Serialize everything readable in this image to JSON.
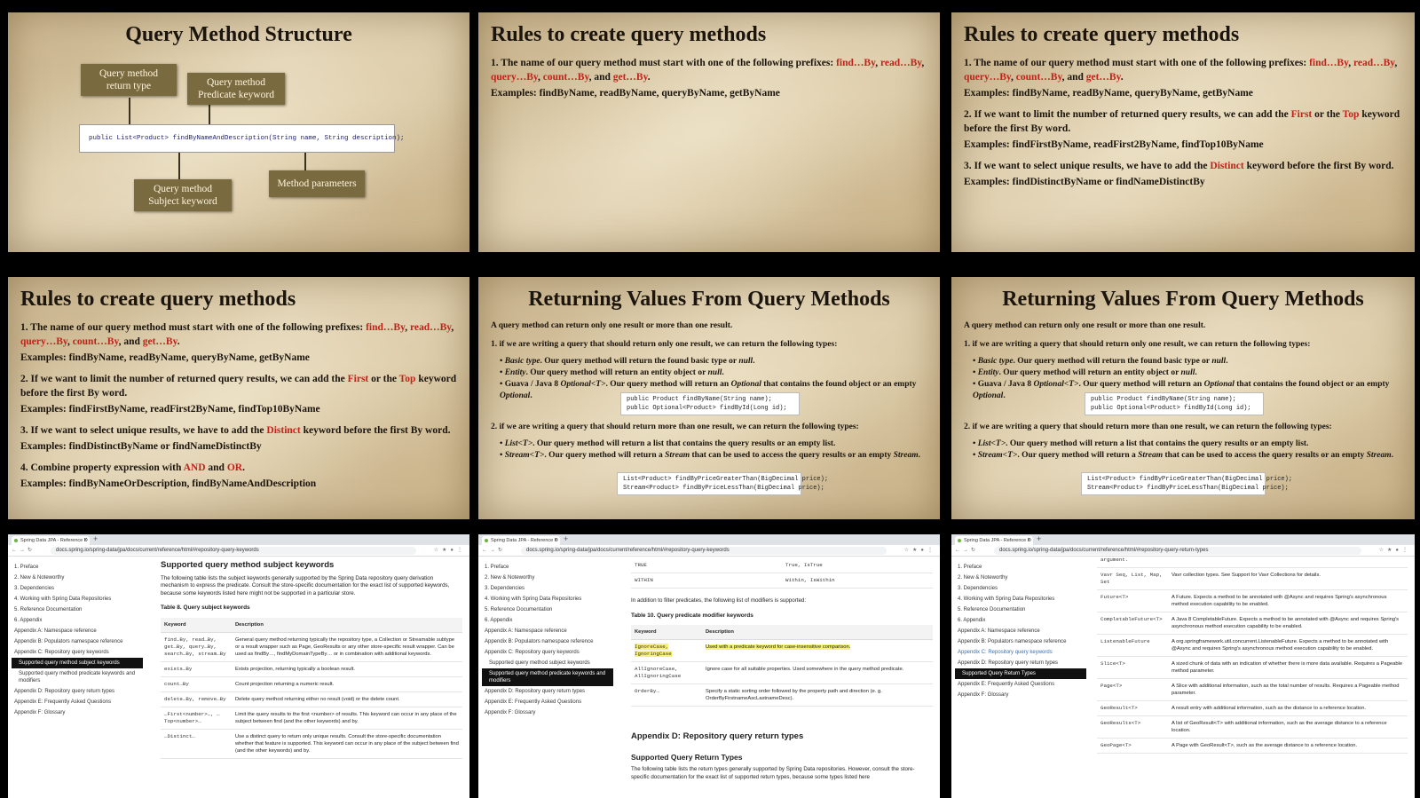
{
  "slide1": {
    "title": "Query Method Structure",
    "box_return": "Query method return type",
    "box_predicate": "Query method Predicate keyword",
    "signature": "public List<Product> findByNameAndDescription(String name, String description);",
    "box_subject": "Query method Subject keyword",
    "box_params": "Method parameters"
  },
  "rules": {
    "title": "Rules to create query methods",
    "r1_text": "1. The name of our query method must start with one of the following prefixes: ",
    "r1_p1": "find…By",
    "r1_p2": "read…By",
    "r1_p3": "query…By",
    "r1_p4": "count…By",
    "r1_and": ", and ",
    "r1_p5": "get…By",
    "r1_ex": "Examples: findByName, readByName, queryByName, getByName",
    "r2_a": "2. If we want to limit the number of returned query results, we can add the ",
    "r2_first": "First",
    "r2_or": " or the ",
    "r2_top": "Top",
    "r2_b": " keyword before the first By word.",
    "r2_ex": "Examples: findFirstByName, readFirst2ByName, findTop10ByName",
    "r3_a": "3. If we want to select unique results, we have to add the ",
    "r3_distinct": "Distinct",
    "r3_b": " keyword before the first By word.",
    "r3_ex": "Examples: findDistinctByName or findNameDistinctBy",
    "r4_a": "4. Combine property expression with ",
    "r4_and": "AND",
    "r4_mid": " and ",
    "r4_or": "OR",
    "r4_ex": "Examples: findByNameOrDescription, findByNameAndDescription"
  },
  "returning": {
    "title": "Returning Values From Query Methods",
    "intro": "A query method can return only one result or more than one result.",
    "one": "1. if we are writing a query that should return only one result, we can return the following types:",
    "b1_label": "Basic type",
    "b1_text": ". Our query method will return the found basic type or ",
    "b1_null": "null",
    "b2_label": "Entity",
    "b2_text": ". Our query method will return an entity object or ",
    "b2_null": "null",
    "b3_a": "Guava / Java 8 ",
    "b3_opt": "Optional<T>",
    "b3_b": ". Our query method will return an ",
    "b3_opt2": "Optional",
    "b3_c": " that contains the found object or an empty ",
    "b3_opt3": "Optional",
    "code1_a": "public Product findByName(String name);",
    "code1_b": "public Optional<Product> findById(Long id);",
    "many": "2. if we are writing a query that should return more than one result, we can return the following types:",
    "m1_label": "List<T>",
    "m1_text": ". Our query method will return a list that contains the query results or an empty list.",
    "m2_label": "Stream<T>",
    "m2_text": ". Our query method will return a ",
    "m2_stream": "Stream",
    "m2_text2": " that can be used to access the query results or an empty ",
    "m2_stream2": "Stream",
    "code2_a": "List<Product> findByPriceGreaterThan(BigDecimal price);",
    "code2_b": "Stream<Product> findByPriceLessThan(BigDecimal price);"
  },
  "browser": {
    "tab": "Spring Data JPA - Reference D",
    "url1": "docs.spring.io/spring-data/jpa/docs/current/reference/html/#repository-query-keywords",
    "url3": "docs.spring.io/spring-data/jpa/docs/current/reference/html/#repository-query-return-types",
    "nav": [
      "1. Preface",
      "2. New & Noteworthy",
      "3. Dependencies",
      "4. Working with Spring Data Repositories",
      "5. Reference Documentation",
      "6. Appendix",
      "Appendix A: Namespace reference",
      "Appendix B: Populators namespace reference",
      "Appendix C: Repository query keywords",
      "Supported query method subject keywords",
      "Supported query method predicate keywords and modifiers",
      "Appendix D: Repository query return types",
      "Appendix E: Frequently Asked Questions",
      "Appendix F: Glossary"
    ],
    "nav3": [
      "1. Preface",
      "2. New & Noteworthy",
      "3. Dependencies",
      "4. Working with Spring Data Repositories",
      "5. Reference Documentation",
      "6. Appendix",
      "Appendix A: Namespace reference",
      "Appendix B: Populators namespace reference",
      "Appendix C: Repository query keywords",
      "Appendix D: Repository query return types",
      "Supported Query Return Types",
      "Appendix E: Frequently Asked Questions",
      "Appendix F: Glossary"
    ],
    "p1": {
      "h": "Supported query method subject keywords",
      "intro": "The following table lists the subject keywords generally supported by the Spring Data repository query derivation mechanism to express the predicate. Consult the store-specific documentation for the exact list of supported keywords, because some keywords listed here might not be supported in a particular store.",
      "cap": "Table 8. Query subject keywords",
      "th1": "Keyword",
      "th2": "Description",
      "rows": [
        [
          "find…By, read…By, get…By, query…By, search…By, stream…By",
          "General query method returning typically the repository type, a Collection or Streamable subtype or a result wrapper such as Page, GeoResults or any other store-specific result wrapper. Can be used as findBy…, findMyDomainTypeBy… or in combination with additional keywords."
        ],
        [
          "exists…By",
          "Exists projection, returning typically a boolean result."
        ],
        [
          "count…By",
          "Count projection returning a numeric result."
        ],
        [
          "delete…By, remove…By",
          "Delete query method returning either no result (void) or the delete count."
        ],
        [
          "…First<number>…, …Top<number>…",
          "Limit the query results to the first <number> of results. This keyword can occur in any place of the subject between find (and the other keywords) and by."
        ],
        [
          "…Distinct…",
          "Use a distinct query to return only unique results. Consult the store-specific documentation whether that feature is supported. This keyword can occur in any place of the subject between find (and the other keywords) and by."
        ]
      ]
    },
    "p2": {
      "r1k": "TRUE",
      "r1v": "True, IsTrue",
      "r2k": "WITHIN",
      "r2v": "Within, IsWithin",
      "intro": "In addition to filter predicates, the following list of modifiers is supported:",
      "cap": "Table 10. Query predicate modifier keywords",
      "th1": "Keyword",
      "th2": "Description",
      "rows": [
        [
          "IgnoreCase, IgnoringCase",
          "Used with a predicate keyword for case-insensitive comparison."
        ],
        [
          "AllIgnoreCase, AllIgnoringCase",
          "Ignore case for all suitable properties. Used somewhere in the query method predicate."
        ],
        [
          "OrderBy…",
          "Specify a static sorting order followed by the property path and direction (e. g. OrderByFirstnameAscLastnameDesc)."
        ]
      ],
      "h1": "Appendix D: Repository query return types",
      "h2": "Supported Query Return Types",
      "outro": "The following table lists the return types generally supported by Spring Data repositories. However, consult the store-specific documentation for the exact list of supported return types, because some types listed here"
    },
    "p3": {
      "top": "argument.",
      "rows": [
        [
          "Vavr Seq, List, Map, Set",
          "Vavr collection types. See Support for Vavr Collections for details."
        ],
        [
          "Future<T>",
          "A Future. Expects a method to be annotated with @Async and requires Spring's asynchronous method execution capability to be enabled."
        ],
        [
          "CompletableFuture<T>",
          "A Java 8 CompletableFuture. Expects a method to be annotated with @Async and requires Spring's asynchronous method execution capability to be enabled."
        ],
        [
          "ListenableFuture",
          "A org.springframework.util.concurrent.ListenableFuture. Expects a method to be annotated with @Async and requires Spring's asynchronous method execution capability to be enabled."
        ],
        [
          "Slice<T>",
          "A sized chunk of data with an indication of whether there is more data available. Requires a Pageable method parameter."
        ],
        [
          "Page<T>",
          "A Slice with additional information, such as the total number of results. Requires a Pageable method parameter."
        ],
        [
          "GeoResult<T>",
          "A result entry with additional information, such as the distance to a reference location."
        ],
        [
          "GeoResults<T>",
          "A list of GeoResult<T> with additional information, such as the average distance to a reference location."
        ],
        [
          "GeoPage<T>",
          "A Page with GeoResult<T>, such as the average distance to a reference location."
        ]
      ]
    }
  }
}
